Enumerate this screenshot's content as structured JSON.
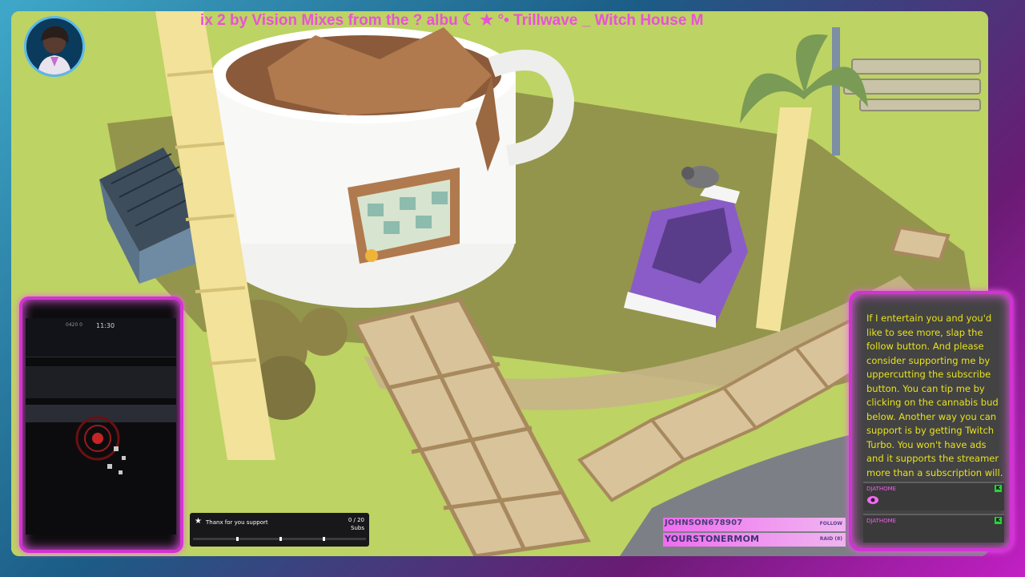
{
  "now_playing": "ix 2 by Vision Mixes from the ? albu ☾ ★ °• Trillwave _ Witch House M",
  "chat": {
    "message_main": "If I entertain you and you'd like to see more, slap the follow button. And please consider supporting me by uppercutting the subscribe button. You can tip me by clicking on the cannabis bud below. Another way you can support is by getting Twitch Turbo. You won't have ads and it supports the streamer more than a subscription will.",
    "messages": [
      {
        "name": "DJATHOME",
        "badge": "K"
      },
      {
        "name": "DJATHOME",
        "badge": "K"
      }
    ]
  },
  "sub_goal": {
    "label": "Thanx for you support",
    "count": "0 / 20",
    "unit": "Subs",
    "progress": 0
  },
  "alerts": [
    {
      "name": "JOHNSON678907",
      "type": "FOLLOW"
    },
    {
      "name": "YOURSTONERMOM",
      "type": "RAID (8)"
    }
  ],
  "cam_game": {
    "timer": "11:30",
    "score": "0420 0"
  },
  "colors": {
    "neon_pink": "#d233d4",
    "neon_blue": "#4fb7e3",
    "chat_text": "#e6e21e"
  }
}
